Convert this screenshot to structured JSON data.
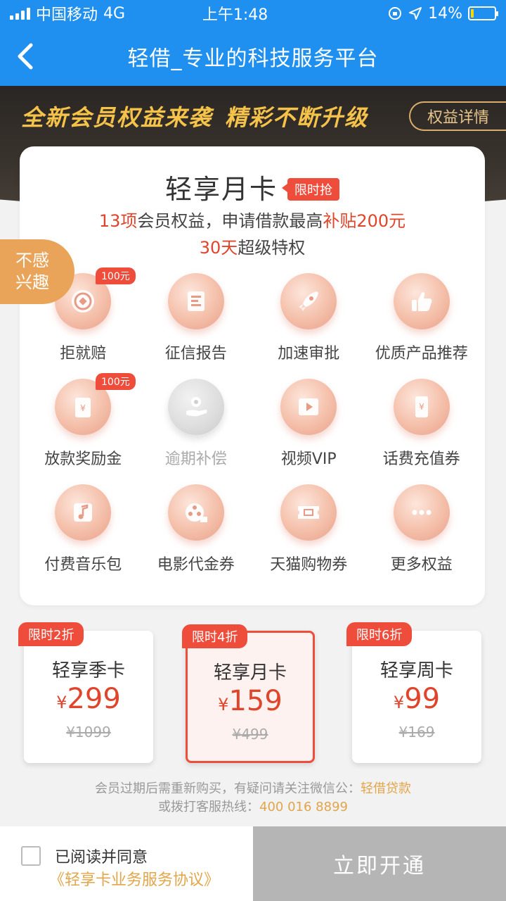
{
  "status": {
    "carrier": "中国移动",
    "network": "4G",
    "time": "上午1:48",
    "battery": "14%",
    "battery_level": 0.14
  },
  "nav": {
    "title": "轻借_专业的科技服务平台"
  },
  "banner": {
    "text1": "全新会员权益来袭",
    "text2": "精彩不断升级",
    "rights_button": "权益详情"
  },
  "side_tab": {
    "line1": "不感",
    "line2": "兴趣"
  },
  "card": {
    "title": "轻享月卡",
    "tag": "限时抢",
    "sub1_a": "13项",
    "sub1_b": "会员权益，申请借款最高",
    "sub1_c": "补贴200元",
    "sub2_a": "30天",
    "sub2_b": "超级特权",
    "benefits": [
      {
        "label": "拒就赔",
        "icon": "coin-icon",
        "badge": "100元"
      },
      {
        "label": "征信报告",
        "icon": "scroll-icon"
      },
      {
        "label": "加速审批",
        "icon": "rocket-icon"
      },
      {
        "label": "优质产品推荐",
        "icon": "thumbs-up-icon"
      },
      {
        "label": "放款奖励金",
        "icon": "red-envelope-icon",
        "badge": "100元"
      },
      {
        "label": "逾期补偿",
        "icon": "hand-coin-icon"
      },
      {
        "label": "视频VIP",
        "icon": "video-play-icon"
      },
      {
        "label": "话费充值券",
        "icon": "phone-yuan-icon"
      },
      {
        "label": "付费音乐包",
        "icon": "music-note-icon"
      },
      {
        "label": "电影代金券",
        "icon": "film-reel-icon"
      },
      {
        "label": "天猫购物券",
        "icon": "ticket-icon"
      },
      {
        "label": "更多权益",
        "icon": "more-dots-icon"
      }
    ]
  },
  "plans": [
    {
      "tag": "限时2折",
      "name": "轻享季卡",
      "currency": "¥",
      "price": "299",
      "old": "¥1099"
    },
    {
      "tag": "限时4折",
      "name": "轻享月卡",
      "currency": "¥",
      "price": "159",
      "old": "¥499"
    },
    {
      "tag": "限时6折",
      "name": "轻享周卡",
      "currency": "¥",
      "price": "99",
      "old": "¥169"
    }
  ],
  "footnote": {
    "line1": "会员过期后需重新购买，有疑问请关注微信公：",
    "wechat": "轻借贷款",
    "line2": "或拨打客服热线：",
    "phone": "400 016 8899"
  },
  "bottom": {
    "agree_text": "已阅读并同意",
    "agreement_link": "《轻享卡业务服务协议》",
    "open_button": "立即开通"
  },
  "colors": {
    "nav_blue": "#1f8ff0",
    "accent_red": "#ef4d3c",
    "gold": "#e2a54a",
    "disabled_gray": "#b5b5b5"
  }
}
